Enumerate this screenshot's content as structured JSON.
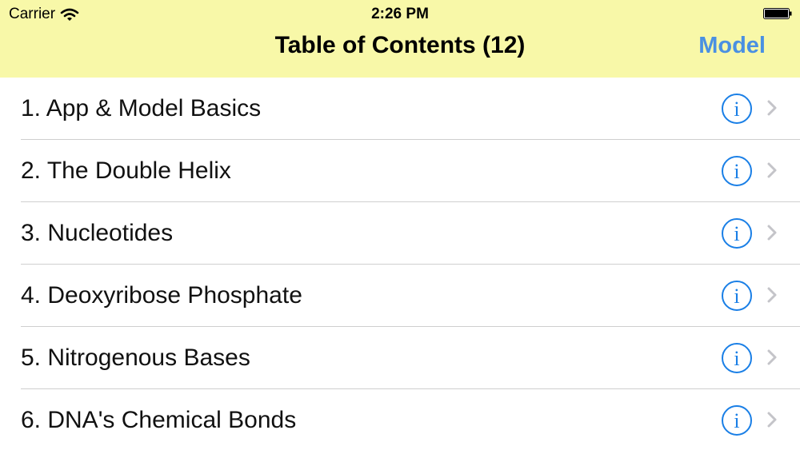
{
  "status_bar": {
    "carrier": "Carrier",
    "time": "2:26 PM",
    "wifi_icon": "wifi-icon",
    "battery_icon": "battery-icon"
  },
  "nav": {
    "title": "Table of Contents (12)",
    "right_button": "Model",
    "background_color": "#f8f8a8",
    "accent_color": "#4a90e2"
  },
  "items": [
    {
      "label": "1. App & Model Basics"
    },
    {
      "label": "2. The Double Helix"
    },
    {
      "label": "3. Nucleotides"
    },
    {
      "label": "4. Deoxyribose Phosphate"
    },
    {
      "label": "5. Nitrogenous Bases"
    },
    {
      "label": "6. DNA's Chemical Bonds"
    }
  ],
  "row_accessories": {
    "info_icon": "info-circle-icon",
    "disclosure_icon": "chevron-right-icon"
  }
}
